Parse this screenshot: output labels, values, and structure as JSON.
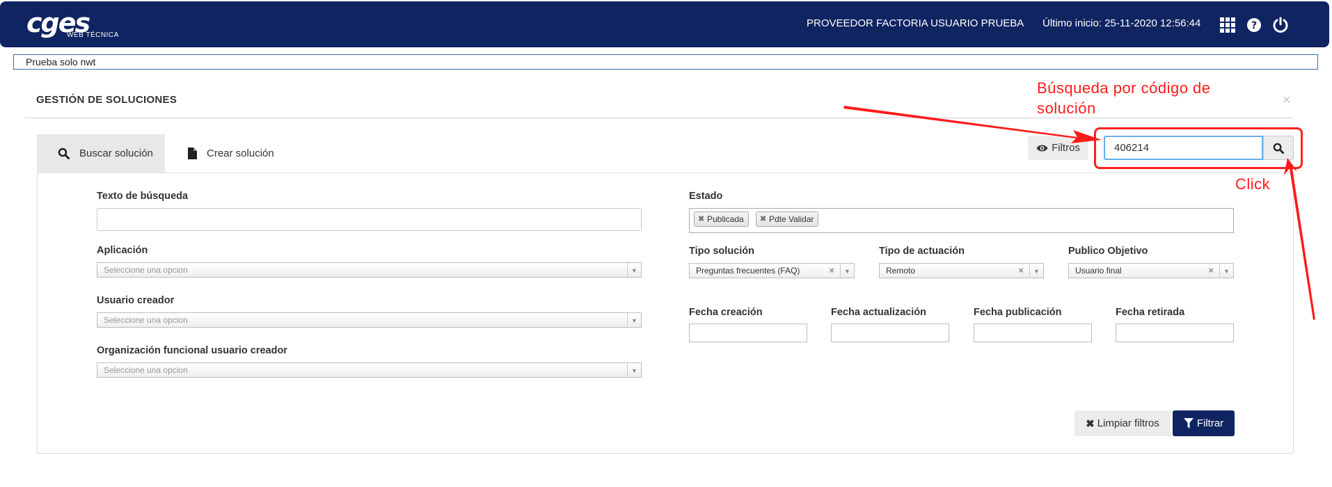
{
  "header": {
    "logo_main": "cges",
    "logo_sub": "WEB TÉCNICA",
    "user_name": "PROVEEDOR FACTORIA USUARIO PRUEBA",
    "last_login": "Último inicio: 25-11-2020 12:56:44",
    "icons": [
      "apps-grid-icon",
      "help-icon",
      "power-icon"
    ]
  },
  "notice": "Prueba solo nwt",
  "page": {
    "title": "GESTIÓN DE SOLUCIONES",
    "close": "×"
  },
  "tabs": [
    {
      "label": "Buscar solución",
      "icon": "search-icon",
      "active": true
    },
    {
      "label": "Crear solución",
      "icon": "file-icon",
      "active": false
    }
  ],
  "toolbar": {
    "filtros_label": "Filtros",
    "code_search_value": "406214"
  },
  "form": {
    "texto_busqueda": {
      "label": "Texto de búsqueda",
      "value": ""
    },
    "aplicacion": {
      "label": "Aplicación",
      "placeholder": "Seleccione una opcion"
    },
    "usuario_creador": {
      "label": "Usuario creador",
      "placeholder": "Seleccione una opcion"
    },
    "org_funcional": {
      "label": "Organización funcional usuario creador",
      "placeholder": "Seleccione una opcion"
    },
    "estado": {
      "label": "Estado",
      "chips": [
        "Publicada",
        "Pdte Validar"
      ]
    },
    "tipo_solucion": {
      "label": "Tipo solución",
      "value": "Preguntas frecuentes (FAQ)"
    },
    "tipo_actuacion": {
      "label": "Tipo de actuación",
      "value": "Remoto"
    },
    "publico_objetivo": {
      "label": "Publico Objetivo",
      "value": "Usuario final"
    },
    "fecha_creacion": {
      "label": "Fecha creación",
      "value": ""
    },
    "fecha_actualizacion": {
      "label": "Fecha actualización",
      "value": ""
    },
    "fecha_publicacion": {
      "label": "Fecha publicación",
      "value": ""
    },
    "fecha_retirada": {
      "label": "Fecha retirada",
      "value": ""
    }
  },
  "actions": {
    "clear_label": "Limpiar filtros",
    "filter_label": "Filtrar"
  },
  "annotations": {
    "search_hint_line1": "Búsqueda por código de",
    "search_hint_line2": "solución",
    "click_hint": "Click",
    "color": "#ff1a1a"
  },
  "colors": {
    "brand_navy": "#0f2461",
    "focus_blue": "#66afe9"
  }
}
